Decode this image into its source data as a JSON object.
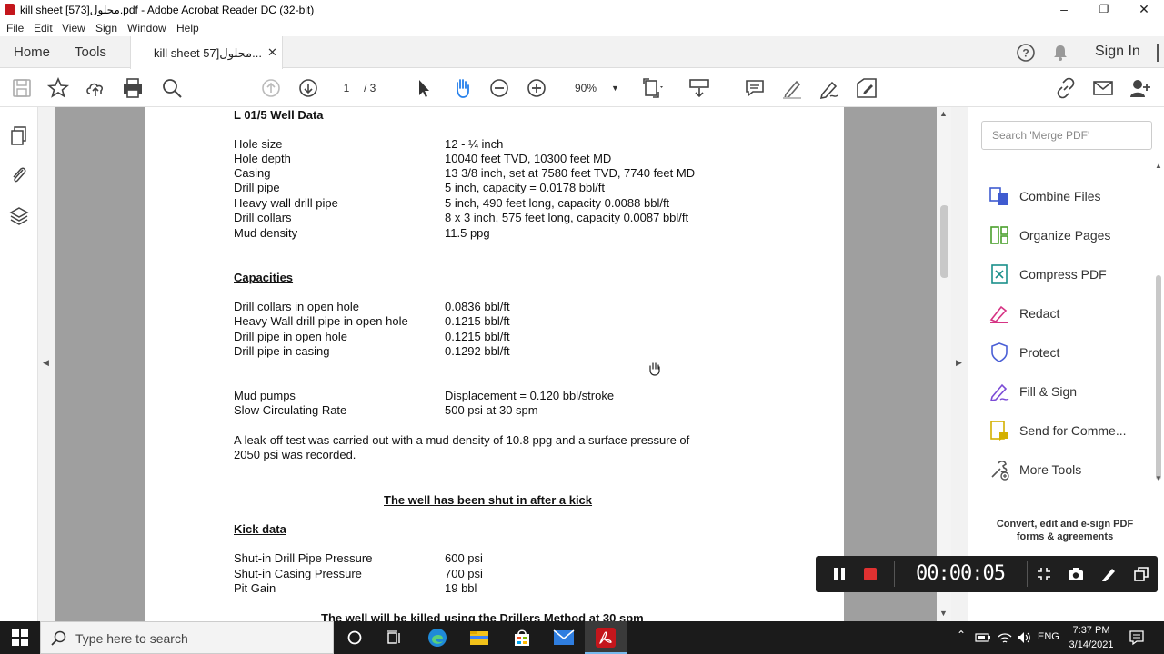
{
  "window": {
    "title": "kill sheet محلول[573].pdf - Adobe Acrobat Reader DC (32-bit)"
  },
  "menu": [
    "File",
    "Edit",
    "View",
    "Sign",
    "Window",
    "Help"
  ],
  "tabs": {
    "home": "Home",
    "tools": "Tools",
    "doc_tab": "kill sheet 57]محلول...",
    "sign_in": "Sign In"
  },
  "toolbar": {
    "page_current": "1",
    "page_total": "/ 3",
    "zoom": "90%"
  },
  "document": {
    "heading": "L 01/5 Well Data",
    "well_data": [
      {
        "label": "Hole size",
        "value": "12 - ¼  inch"
      },
      {
        "label": "Hole depth",
        "value": "10040 feet TVD, 10300 feet MD"
      },
      {
        "label": "Casing",
        "value": "13 3/8 inch, set at 7580 feet TVD, 7740 feet MD"
      },
      {
        "label": "Drill pipe",
        "value": "5 inch, capacity = 0.0178 bbl/ft"
      },
      {
        "label": "Heavy wall drill pipe",
        "value": "5 inch, 490 feet long, capacity 0.0088 bbl/ft"
      },
      {
        "label": "Drill collars",
        "value": "8 x 3 inch, 575 feet long, capacity 0.0087 bbl/ft"
      },
      {
        "label": "Mud density",
        "value": "11.5 ppg"
      }
    ],
    "capacities_heading": "Capacities",
    "capacities": [
      {
        "label": "Drill collars in open hole",
        "value": "0.0836 bbl/ft"
      },
      {
        "label": "Heavy Wall drill pipe in open hole",
        "value": "0.1215 bbl/ft"
      },
      {
        "label": "Drill pipe in open hole",
        "value": "0.1215 bbl/ft"
      },
      {
        "label": "Drill pipe in casing",
        "value": "0.1292 bbl/ft"
      }
    ],
    "pumps": [
      {
        "label": "Mud pumps",
        "value": "Displacement = 0.120 bbl/stroke"
      },
      {
        "label": "Slow Circulating Rate",
        "value": "500 psi at 30 spm"
      }
    ],
    "leakoff_line1": "A leak-off test was carried out with a mud density of 10.8 ppg and a surface pressure of",
    "leakoff_line2": "2050 psi was recorded.",
    "shut_in_heading": "The well has been shut in after a kick",
    "kick_heading": "Kick data",
    "kick_data": [
      {
        "label": "Shut-in Drill Pipe Pressure",
        "value": "600 psi"
      },
      {
        "label": "Shut-in Casing Pressure",
        "value": "700 psi"
      },
      {
        "label": "Pit Gain",
        "value": "19 bbl"
      }
    ],
    "footer_line": "The well will be killed using the Drillers Method at 30 spm"
  },
  "right_panel": {
    "search_placeholder": "Search 'Merge PDF'",
    "tools": [
      {
        "label": "Combine Files",
        "color": "#3f5bd0"
      },
      {
        "label": "Organize Pages",
        "color": "#4aa02c"
      },
      {
        "label": "Compress PDF",
        "color": "#1a8f8a"
      },
      {
        "label": "Redact",
        "color": "#d63384"
      },
      {
        "label": "Protect",
        "color": "#4a5fd6"
      },
      {
        "label": "Fill & Sign",
        "color": "#7b4bd6"
      },
      {
        "label": "Send for Comme...",
        "color": "#d4b000"
      },
      {
        "label": "More Tools",
        "color": "#555555"
      }
    ],
    "promo_line1": "Convert, edit and e-sign PDF",
    "promo_line2": "forms & agreements"
  },
  "recorder": {
    "time": "00:00:05"
  },
  "taskbar": {
    "search_placeholder": "Type here to search",
    "lang": "ENG",
    "time": "7:37 PM",
    "date": "3/14/2021"
  },
  "colors": {
    "acrobat_red": "#c4161c",
    "accent_blue": "#2680eb"
  }
}
